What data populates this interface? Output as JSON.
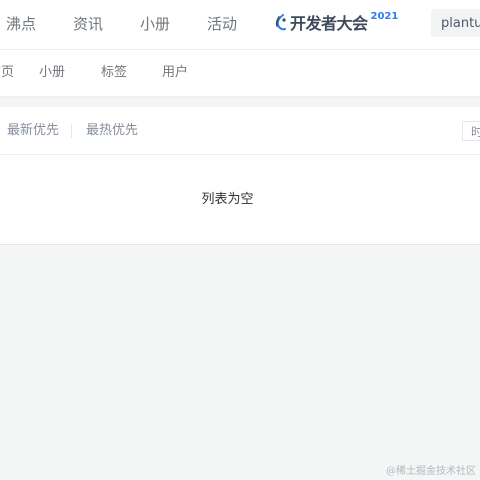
{
  "top_nav": {
    "items": [
      "沸点",
      "资讯",
      "小册",
      "活动"
    ],
    "event": {
      "name": "开发者大会",
      "year": "2021",
      "icon": "conference-flame-icon",
      "accent": "#2d7df6"
    },
    "search": {
      "value": "plantuml"
    }
  },
  "sub_nav": {
    "items": [
      "首页",
      "小册",
      "标签",
      "用户"
    ]
  },
  "sort_bar": {
    "options": [
      "最新优先",
      "最热优先"
    ],
    "time_filter": "时间不限"
  },
  "list": {
    "empty_text": "列表为空"
  },
  "watermark": "@稀土掘金技术社区"
}
